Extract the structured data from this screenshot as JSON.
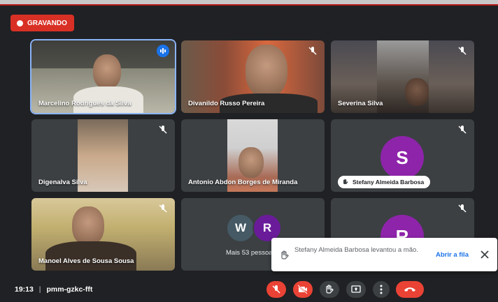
{
  "recording": {
    "label": "GRAVANDO"
  },
  "tiles": [
    {
      "name": "Marcelino Rodrigues da Silva"
    },
    {
      "name": "Divanildo Russo Pereira"
    },
    {
      "name": "Severina Silva"
    },
    {
      "name": "Digenalva Silva"
    },
    {
      "name": "Antonio Abdon Borges de Miranda"
    },
    {
      "name": "Stefany Almeida Barbosa",
      "avatar": "S",
      "avatar_color": "#8e24aa"
    },
    {
      "name": "Manoel Alves de Sousa Sousa"
    },
    {
      "more_label": "Mais 53 pessoas",
      "avatars": [
        "W",
        "R"
      ]
    },
    {
      "avatar": "R",
      "avatar_color": "#8e24aa"
    }
  ],
  "toast": {
    "message": "Stefany Almeida Barbosa levantou a mão.",
    "action": "Abrir a fila"
  },
  "meeting": {
    "time": "19:13",
    "separator": "|",
    "code": "pmm-gzkc-fft"
  },
  "colors": {
    "accent": "#8ab4f8",
    "danger": "#ea4335",
    "link": "#1a73e8"
  }
}
